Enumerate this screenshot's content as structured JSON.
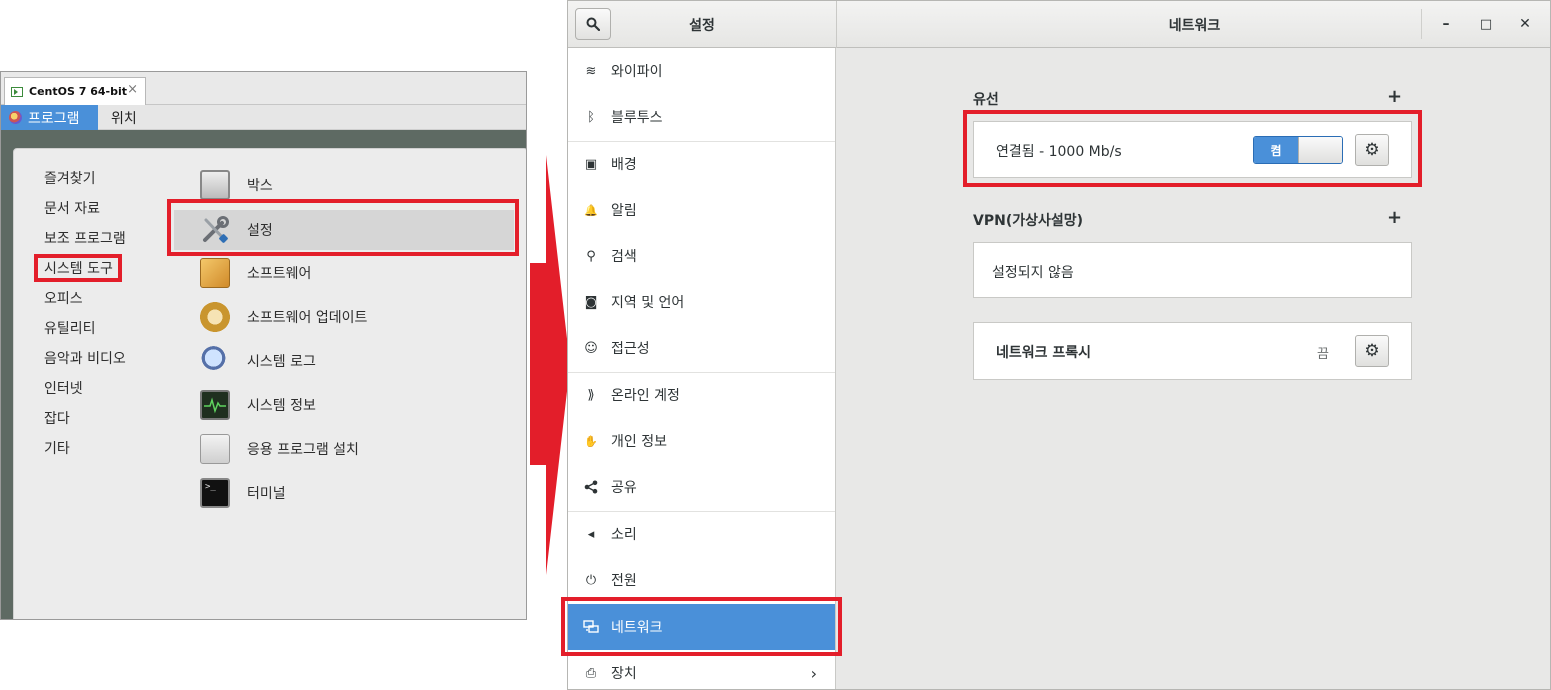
{
  "vm": {
    "tab_title": "CentOS 7 64-bit"
  },
  "topbar": {
    "apps_label": "프로그램",
    "places_label": "위치"
  },
  "menu": {
    "categories": [
      "즐겨찾기",
      "문서 자료",
      "보조 프로그램",
      "시스템 도구",
      "오피스",
      "유틸리티",
      "음악과 비디오",
      "인터넷",
      "잡다",
      "기타"
    ],
    "apps": [
      {
        "label": "박스",
        "icon": "boxes-icon"
      },
      {
        "label": "설정",
        "icon": "settings-tools-icon"
      },
      {
        "label": "소프트웨어",
        "icon": "software-icon"
      },
      {
        "label": "소프트웨어 업데이트",
        "icon": "software-update-icon"
      },
      {
        "label": "시스템 로그",
        "icon": "system-log-icon"
      },
      {
        "label": "시스템 정보",
        "icon": "system-monitor-icon"
      },
      {
        "label": "응용 프로그램 설치",
        "icon": "app-install-icon"
      },
      {
        "label": "터미널",
        "icon": "terminal-icon"
      }
    ]
  },
  "settings": {
    "sidebar_title": "설정",
    "main_title": "네트워크",
    "window_controls": {
      "minimize": "–",
      "maximize": "□",
      "close": "✕"
    },
    "sidebar": [
      {
        "label": "와이파이",
        "icon": "wifi-icon",
        "glyph": "≋"
      },
      {
        "label": "블루투스",
        "icon": "bluetooth-icon",
        "glyph": "ᛒ"
      },
      {
        "label": "배경",
        "icon": "background-icon",
        "glyph": "▣"
      },
      {
        "label": "알림",
        "icon": "bell-icon",
        "glyph": "🔔"
      },
      {
        "label": "검색",
        "icon": "search-icon",
        "glyph": "⚲"
      },
      {
        "label": "지역 및 언어",
        "icon": "region-icon",
        "glyph": "◙"
      },
      {
        "label": "접근성",
        "icon": "accessibility-icon",
        "glyph": "☺"
      },
      {
        "label": "온라인 계정",
        "icon": "online-accounts-icon",
        "glyph": "⟫"
      },
      {
        "label": "개인 정보",
        "icon": "privacy-hand-icon",
        "glyph": "✋"
      },
      {
        "label": "공유",
        "icon": "share-icon",
        "glyph": "⋖"
      },
      {
        "label": "소리",
        "icon": "speaker-icon",
        "glyph": "◂"
      },
      {
        "label": "전원",
        "icon": "power-plug-icon",
        "glyph": "⏻"
      },
      {
        "label": "네트워크",
        "icon": "network-icon",
        "glyph": "🖧"
      },
      {
        "label": "장치",
        "icon": "devices-icon",
        "glyph": "⎙"
      }
    ],
    "wired": {
      "title": "유선",
      "add": "+",
      "status": "연결됨 - 1000 Mb/s",
      "toggle_on": "켬",
      "gear": "⚙"
    },
    "vpn": {
      "title": "VPN(가상사설망)",
      "add": "+",
      "status": "설정되지 않음"
    },
    "proxy": {
      "label": "네트워크 프록시",
      "state": "끔",
      "gear": "⚙"
    },
    "chevron": "›"
  },
  "colors": {
    "accent": "#4a90d9",
    "highlight": "#e31e2a"
  }
}
